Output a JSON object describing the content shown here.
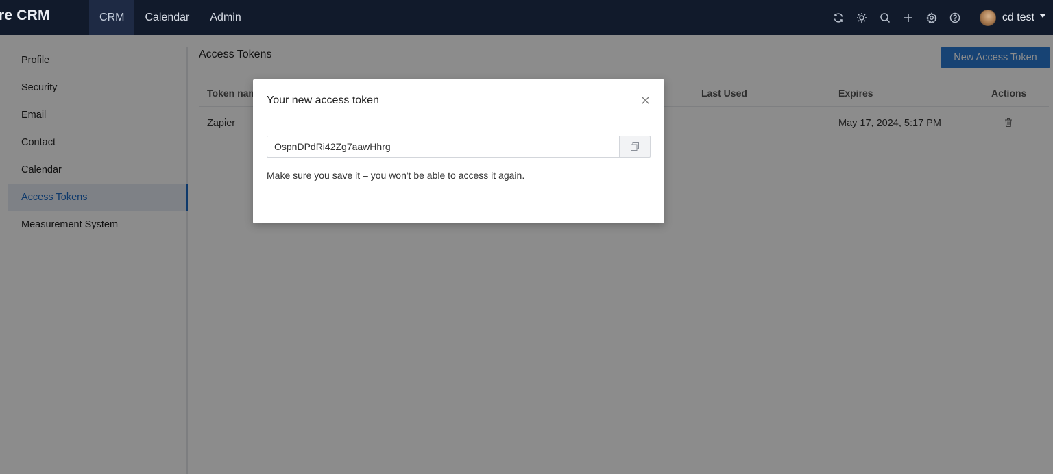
{
  "header": {
    "brand": "re CRM",
    "nav": [
      {
        "label": "CRM",
        "active": true
      },
      {
        "label": "Calendar",
        "active": false
      },
      {
        "label": "Admin",
        "active": false
      }
    ],
    "icons": [
      "refresh-icon",
      "sun-icon",
      "search-icon",
      "plus-icon",
      "gear-icon",
      "help-icon"
    ],
    "user_name": "cd test"
  },
  "sidebar": {
    "items": [
      {
        "label": "Profile"
      },
      {
        "label": "Security"
      },
      {
        "label": "Email"
      },
      {
        "label": "Contact"
      },
      {
        "label": "Calendar"
      },
      {
        "label": "Access Tokens",
        "active": true
      },
      {
        "label": "Measurement System"
      }
    ]
  },
  "main": {
    "title": "Access Tokens",
    "new_button": "New Access Token",
    "columns": [
      "Token name",
      "Last Used",
      "Expires",
      "Actions"
    ],
    "rows": [
      {
        "name": "Zapier",
        "last_used": "",
        "expires": "May 17, 2024, 5:17 PM"
      }
    ]
  },
  "modal": {
    "title": "Your new access token",
    "token": "OspnDPdRi42Zg7aawHhrg",
    "note": "Make sure you save it – you won't be able to access it again."
  },
  "colors": {
    "topbar": "#111a2b",
    "accent": "#2b7bd4",
    "active_text": "#1a69c4"
  }
}
